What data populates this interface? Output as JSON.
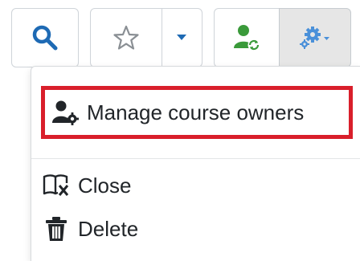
{
  "toolbar": {
    "search_icon": "search-icon",
    "star_icon": "star-icon",
    "caret_icon": "caret-down-icon",
    "owner_icon": "user-sync-icon",
    "gear_icon": "gears-icon"
  },
  "menu": {
    "items": [
      {
        "label": "Manage course owners",
        "icon": "user-gear-icon"
      },
      {
        "label": "Close",
        "icon": "book-close-icon"
      },
      {
        "label": "Delete",
        "icon": "trash-icon"
      }
    ]
  },
  "colors": {
    "primary_blue": "#1e6ab4",
    "light_blue": "#4a90d9",
    "green": "#3a9a3a",
    "highlight_red": "#d91f2b",
    "text": "#212529"
  }
}
